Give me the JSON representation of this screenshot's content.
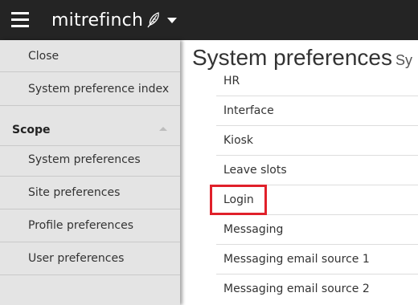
{
  "app": {
    "brand": "mitrefinch",
    "menu_icon": "hamburger-menu-icon",
    "brand_icon": "feather-icon",
    "dropdown_icon": "caret-down-icon"
  },
  "sidebar": {
    "top_items": [
      {
        "label": "Close"
      },
      {
        "label": "System preference index"
      }
    ],
    "scope": {
      "heading": "Scope",
      "collapse_icon": "chevron-up-icon",
      "items": [
        {
          "label": "System preferences"
        },
        {
          "label": "Site preferences"
        },
        {
          "label": "Profile preferences"
        },
        {
          "label": "User preferences"
        }
      ]
    }
  },
  "main": {
    "title": "System preferences",
    "title_suffix": "Sy",
    "rows": [
      {
        "label": "HR"
      },
      {
        "label": "Interface"
      },
      {
        "label": "Kiosk"
      },
      {
        "label": "Leave slots"
      },
      {
        "label": "Login",
        "highlighted": true
      },
      {
        "label": "Messaging"
      },
      {
        "label": "Messaging email source 1"
      },
      {
        "label": "Messaging email source 2"
      }
    ]
  },
  "colors": {
    "topbar": "#242424",
    "sidebar": "#e4e4e4",
    "highlight": "#e0202a"
  }
}
